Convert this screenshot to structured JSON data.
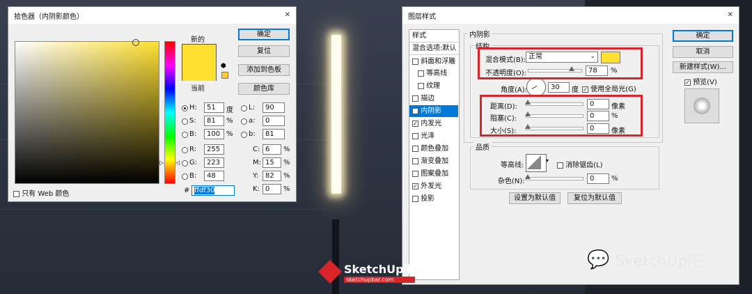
{
  "colors": {
    "picked": "#ffdf30",
    "accent_red": "#d9242a",
    "selection": "#0078d7"
  },
  "picker": {
    "title": "拾色器（内阴影颜色）",
    "new_label": "新的",
    "current_label": "当前",
    "buttons": {
      "ok": "确定",
      "reset": "复位",
      "add_swatch": "添加到色板",
      "libraries": "颜色库"
    },
    "web_only": "只有 Web 颜色",
    "hsb": [
      {
        "key": "H:",
        "value": "51",
        "unit": "度"
      },
      {
        "key": "S:",
        "value": "81",
        "unit": "%"
      },
      {
        "key": "B:",
        "value": "100",
        "unit": "%"
      }
    ],
    "rgb": [
      {
        "key": "R:",
        "value": "255"
      },
      {
        "key": "G:",
        "value": "223"
      },
      {
        "key": "B:",
        "value": "48"
      }
    ],
    "lab": [
      {
        "key": "L:",
        "value": "90"
      },
      {
        "key": "a:",
        "value": "0"
      },
      {
        "key": "b:",
        "value": "81"
      }
    ],
    "cmyk": [
      {
        "key": "C:",
        "value": "6",
        "unit": "%"
      },
      {
        "key": "M:",
        "value": "15",
        "unit": "%"
      },
      {
        "key": "Y:",
        "value": "82",
        "unit": "%"
      },
      {
        "key": "K:",
        "value": "0",
        "unit": "%"
      }
    ],
    "hex_label": "#",
    "hex_value": "ffdf30"
  },
  "layer_style": {
    "title": "图层样式",
    "styles_header": "样式",
    "blend_options": "混合选项:默认",
    "items": [
      {
        "label": "斜面和浮雕",
        "checked": false
      },
      {
        "label": "等高线",
        "checked": false
      },
      {
        "label": "纹理",
        "checked": false
      },
      {
        "label": "描边",
        "checked": false
      },
      {
        "label": "内阴影",
        "checked": true
      },
      {
        "label": "内发光",
        "checked": true
      },
      {
        "label": "光泽",
        "checked": false
      },
      {
        "label": "颜色叠加",
        "checked": false
      },
      {
        "label": "渐变叠加",
        "checked": false
      },
      {
        "label": "图案叠加",
        "checked": false
      },
      {
        "label": "外发光",
        "checked": true
      },
      {
        "label": "投影",
        "checked": false
      }
    ],
    "section_title": "内阴影",
    "structure_title": "结构",
    "blend_mode_label": "混合模式(B):",
    "blend_mode_value": "正常",
    "opacity_label": "不透明度(O):",
    "opacity_value": "78",
    "opacity_unit": "%",
    "angle_label": "角度(A):",
    "angle_value": "30",
    "angle_unit": "度",
    "global_light": "使用全局光(G)",
    "distance_label": "距离(D):",
    "distance_value": "0",
    "distance_unit": "像素",
    "choke_label": "阻塞(C):",
    "choke_value": "0",
    "choke_unit": "%",
    "size_label": "大小(S):",
    "size_value": "0",
    "size_unit": "像素",
    "quality_title": "品质",
    "contour_label": "等高线:",
    "antialias": "消除锯齿(L)",
    "noise_label": "杂色(N):",
    "noise_value": "0",
    "noise_unit": "%",
    "make_default": "设置为默认值",
    "reset_default": "复位为默认值",
    "buttons": {
      "ok": "确定",
      "cancel": "取消",
      "new_style": "新建样式(W)...",
      "preview": "预览(V)"
    }
  },
  "brand": {
    "logo_text": "SketchUp吧",
    "logo_sub": "sketchupbar.com",
    "watermark": "SketchUp吧"
  }
}
